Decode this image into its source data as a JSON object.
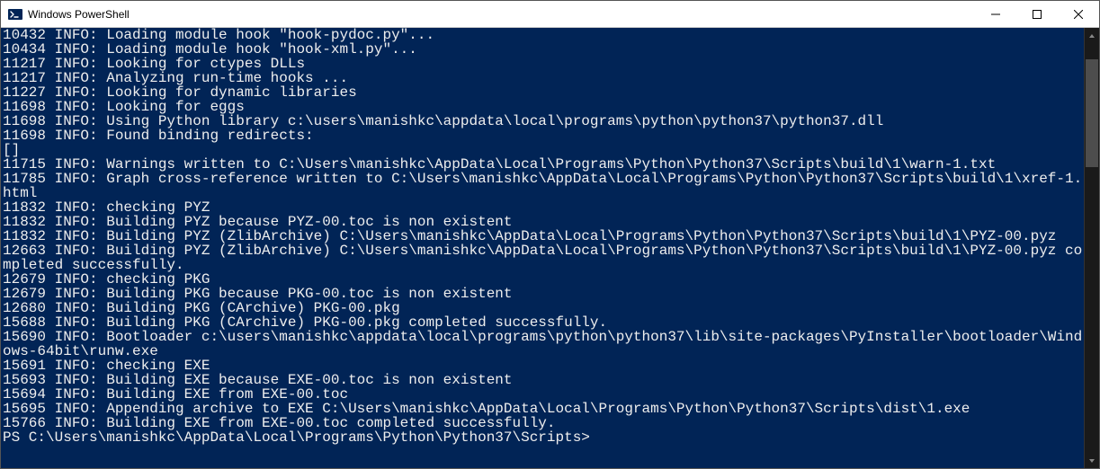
{
  "window": {
    "title": "Windows PowerShell"
  },
  "colors": {
    "terminal_bg": "#012456",
    "terminal_fg": "#eeeeee"
  },
  "log_lines": [
    "10432 INFO: Loading module hook \"hook-pydoc.py\"...",
    "10434 INFO: Loading module hook \"hook-xml.py\"...",
    "11217 INFO: Looking for ctypes DLLs",
    "11217 INFO: Analyzing run-time hooks ...",
    "11227 INFO: Looking for dynamic libraries",
    "11698 INFO: Looking for eggs",
    "11698 INFO: Using Python library c:\\users\\manishkc\\appdata\\local\\programs\\python\\python37\\python37.dll",
    "11698 INFO: Found binding redirects:",
    "[]",
    "11715 INFO: Warnings written to C:\\Users\\manishkc\\AppData\\Local\\Programs\\Python\\Python37\\Scripts\\build\\1\\warn-1.txt",
    "11785 INFO: Graph cross-reference written to C:\\Users\\manishkc\\AppData\\Local\\Programs\\Python\\Python37\\Scripts\\build\\1\\xref-1.html",
    "11832 INFO: checking PYZ",
    "11832 INFO: Building PYZ because PYZ-00.toc is non existent",
    "11832 INFO: Building PYZ (ZlibArchive) C:\\Users\\manishkc\\AppData\\Local\\Programs\\Python\\Python37\\Scripts\\build\\1\\PYZ-00.pyz",
    "12663 INFO: Building PYZ (ZlibArchive) C:\\Users\\manishkc\\AppData\\Local\\Programs\\Python\\Python37\\Scripts\\build\\1\\PYZ-00.pyz completed successfully.",
    "12679 INFO: checking PKG",
    "12679 INFO: Building PKG because PKG-00.toc is non existent",
    "12680 INFO: Building PKG (CArchive) PKG-00.pkg",
    "15688 INFO: Building PKG (CArchive) PKG-00.pkg completed successfully.",
    "15690 INFO: Bootloader c:\\users\\manishkc\\appdata\\local\\programs\\python\\python37\\lib\\site-packages\\PyInstaller\\bootloader\\Windows-64bit\\runw.exe",
    "15691 INFO: checking EXE",
    "15693 INFO: Building EXE because EXE-00.toc is non existent",
    "15694 INFO: Building EXE from EXE-00.toc",
    "15695 INFO: Appending archive to EXE C:\\Users\\manishkc\\AppData\\Local\\Programs\\Python\\Python37\\Scripts\\dist\\1.exe",
    "15766 INFO: Building EXE from EXE-00.toc completed successfully."
  ],
  "prompt": "PS C:\\Users\\manishkc\\AppData\\Local\\Programs\\Python\\Python37\\Scripts> "
}
